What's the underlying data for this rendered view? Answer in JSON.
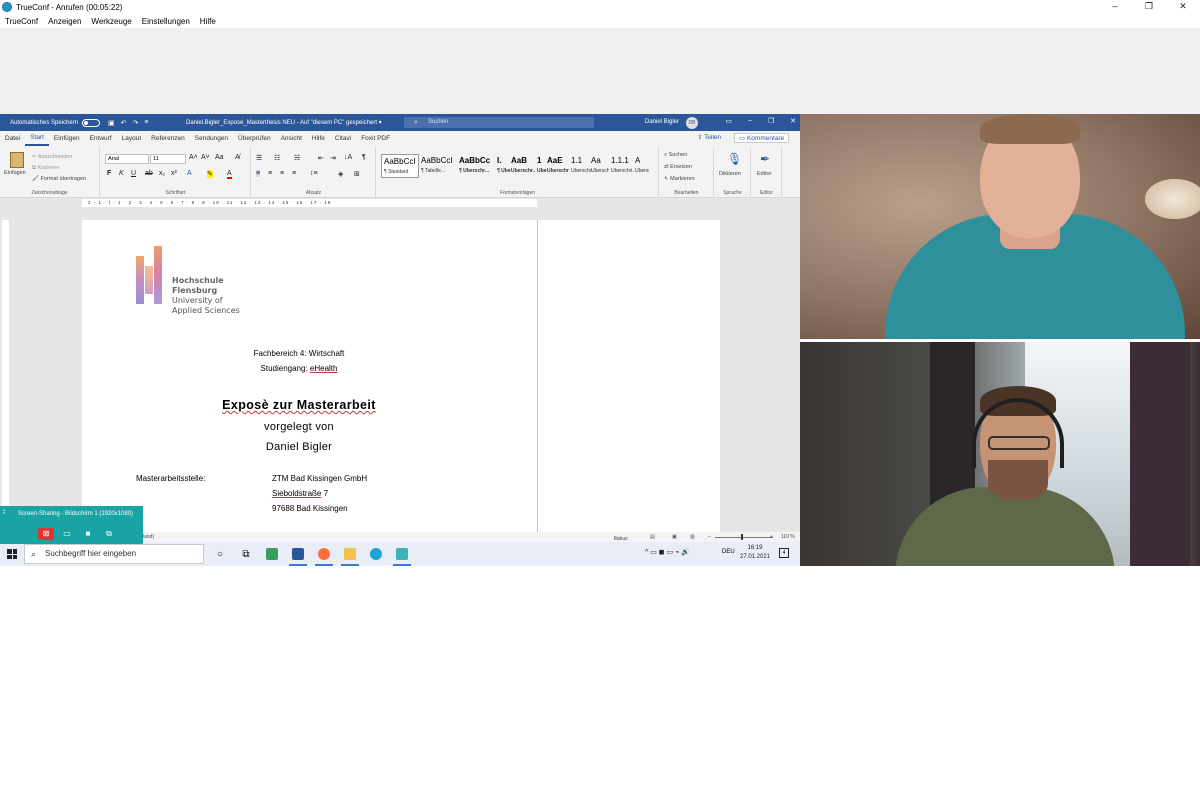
{
  "app": {
    "title": "TrueConf - Anrufen (00:05:22)",
    "window_buttons": [
      "–",
      "❐",
      "✕"
    ],
    "menu": [
      "TrueConf",
      "Anzeigen",
      "Werkzeuge",
      "Einstellungen",
      "Hilfe"
    ]
  },
  "word": {
    "autosave_label": "Automatisches Speichern",
    "doc_title": "Daniel.Bigler_Expose_Masterthesis NEU  -  Auf \"diesem PC\" gespeichert  ▾",
    "search_placeholder": "Suchen",
    "user_name": "Daniel Bigler",
    "user_initials": "DB",
    "tabs": [
      "Datei",
      "Start",
      "Einfügen",
      "Entwurf",
      "Layout",
      "Referenzen",
      "Sendungen",
      "Überprüfen",
      "Ansicht",
      "Hilfe",
      "Citavi",
      "Foxit PDF"
    ],
    "active_tab": "Start",
    "share_label": "Teilen",
    "comments_label": "Kommentare",
    "ribbon": {
      "paste_label": "Einfügen",
      "cut_label": "Ausschneiden",
      "copy_label": "Kopieren",
      "format_painter_label": "Format übertragen",
      "group_clipboard": "Zwischenablage",
      "font_name": "Arial",
      "font_size": "11",
      "group_font": "Schriftart",
      "group_paragraph": "Absatz",
      "group_styles": "Formatvorlagen",
      "styles": [
        {
          "sample": "AaBbCcI",
          "name": "¶ Standard"
        },
        {
          "sample": "AaBbCcI",
          "name": "¶ Tabelle..."
        },
        {
          "sample": "AaBbCc",
          "name": "¶ Überschr..."
        },
        {
          "sample": "I.",
          "name": "¶ Überschr..."
        },
        {
          "sample": "AaB",
          "name": "Überschr..."
        },
        {
          "sample": "1",
          "name": "Überschr..."
        },
        {
          "sample": "AaE",
          "name": "Überschr..."
        },
        {
          "sample": "1.1",
          "name": "Überschr..."
        },
        {
          "sample": "Aa",
          "name": "Überschri..."
        },
        {
          "sample": "1.1.1",
          "name": "Überschri..."
        },
        {
          "sample": "A",
          "name": "Überschr..."
        }
      ],
      "find_label": "Suchen",
      "replace_label": "Ersetzen",
      "select_label": "Markieren",
      "group_editing": "Bearbeiten",
      "dictate_label": "Diktieren",
      "group_voice": "Sprache",
      "editor_label": "Editor",
      "group_editor": "Editor"
    },
    "ruler_text": "2 · 1 · | · 1 · 2 · 3 · 4 · 5 · 6 · 7 · 8 · 9 · 10 · 11 · 12 · 13 · 14 · 15 · 16 · 17 · 18",
    "document": {
      "logo_line1": "Hochschule",
      "logo_line2": "Flensburg",
      "logo_line3": "University of",
      "logo_line4": "Applied Sciences",
      "faculty": "Fachbereich 4: Wirtschaft",
      "program_prefix": "Studiengang: ",
      "program_name": "eHealth",
      "title": "Exposè zur Masterarbeit",
      "submitted_by": "vorgelegt von",
      "author": "Daniel Bigler",
      "thesis_place_label": "Masterarbeitsstelle:",
      "company": "ZTM Bad Kissingen GmbH",
      "street_name": "Sieboldstraße",
      "street_number": " 7",
      "city": "97688 Bad Kissingen"
    },
    "status": {
      "language": "land)",
      "focus": "Fokus",
      "zoom": "110 %"
    }
  },
  "taskbar": {
    "search_placeholder": "Suchbegriff hier eingeben",
    "language": "DEU",
    "time": "16:19",
    "date": "27.01.2021",
    "tray_icons": "^ ▭ ◼ ▭ ⌁ 🔊",
    "notif_count": "4"
  },
  "screen_share": {
    "label": "Screen-Sharing - Bildschirm 1 (1920x1080)",
    "grip": "⁞⁞"
  }
}
